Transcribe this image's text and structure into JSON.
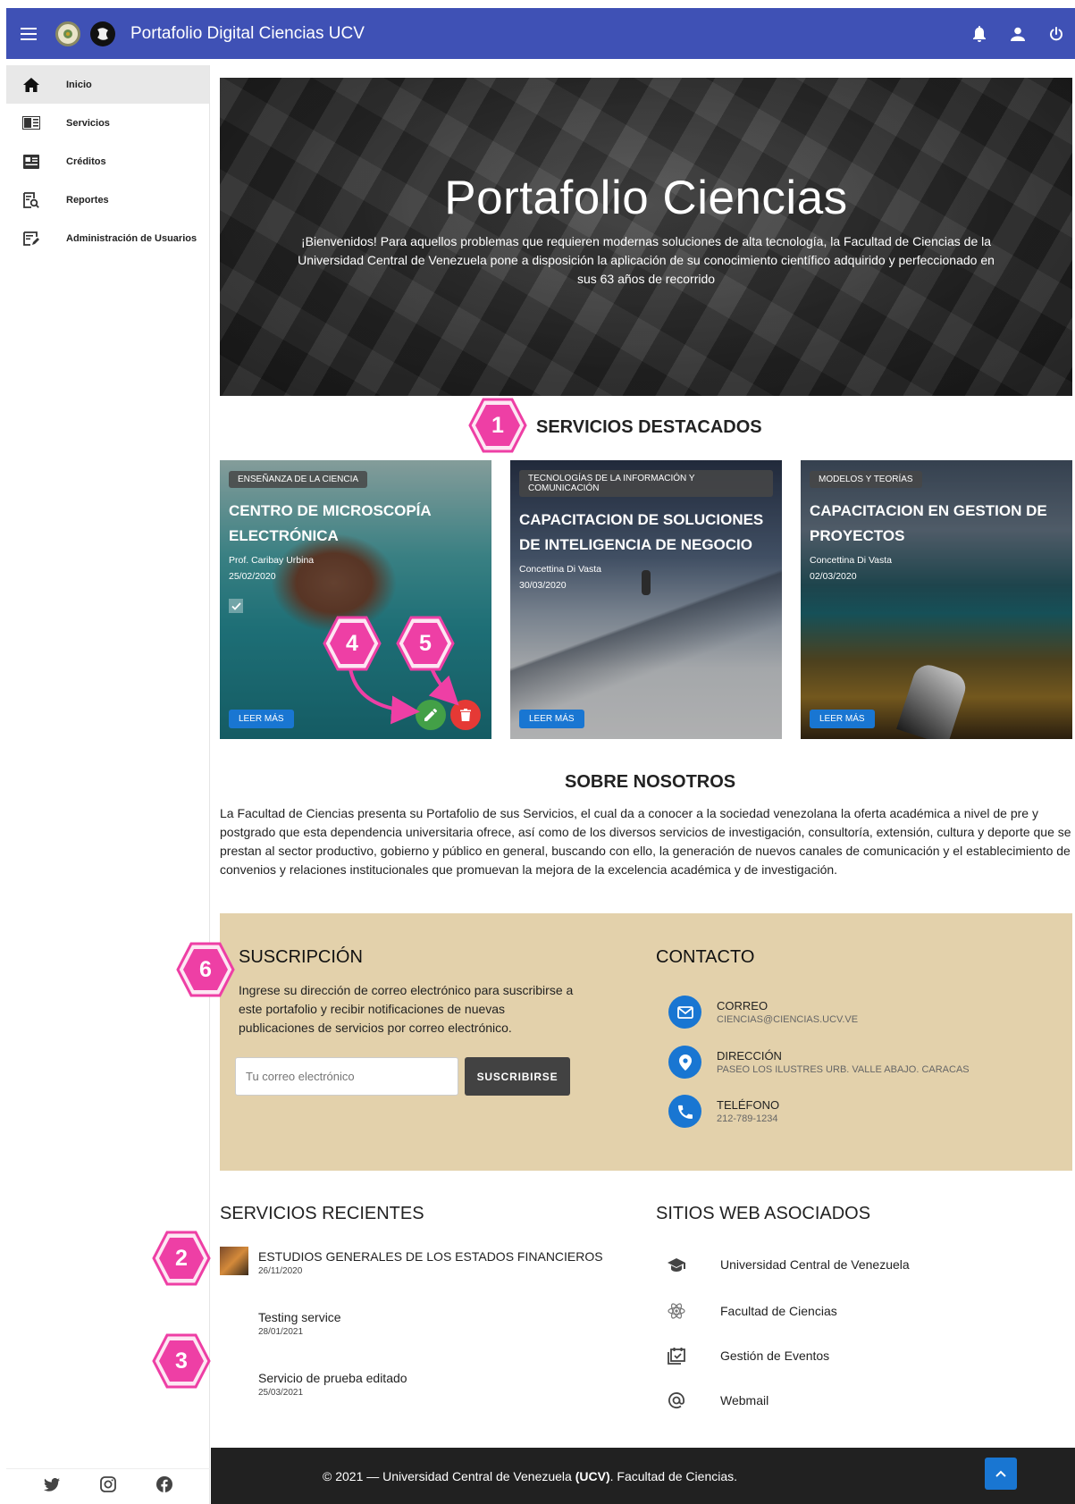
{
  "appbar": {
    "title": "Portafolio Digital Ciencias UCV"
  },
  "sidebar": {
    "items": [
      {
        "label": "Inicio"
      },
      {
        "label": "Servicios"
      },
      {
        "label": "Créditos"
      },
      {
        "label": "Reportes"
      },
      {
        "label": "Administración de Usuarios"
      }
    ]
  },
  "hero": {
    "title": "Portafolio Ciencias",
    "text": "¡Bienvenidos! Para aquellos problemas que requieren modernas soluciones de alta tecnología, la Facultad de Ciencias de la Universidad Central de Venezuela pone a disposición la aplicación de su conocimiento científico adquirido y perfeccionado en sus 63 años de recorrido"
  },
  "featured": {
    "title": "SERVICIOS DESTACADOS",
    "read_more": "LEER MÁS",
    "cards": [
      {
        "category": "ENSEÑANZA DE LA CIENCIA",
        "title": "CENTRO DE MICROSCOPÍA ELECTRÓNICA",
        "author": "Prof. Caribay Urbina",
        "date": "25/02/2020"
      },
      {
        "category": "TECNOLOGÍAS DE LA INFORMACIÓN Y COMUNICACIÓN",
        "title": "CAPACITACION DE SOLUCIONES DE INTELIGENCIA DE NEGOCIO",
        "author": "Concettina Di Vasta",
        "date": "30/03/2020"
      },
      {
        "category": "MODELOS Y TEORÍAS",
        "title": "CAPACITACION EN GESTION DE PROYECTOS",
        "author": "Concettina Di Vasta",
        "date": "02/03/2020"
      }
    ]
  },
  "about": {
    "title": "SOBRE NOSOTROS",
    "text": "La Facultad de Ciencias presenta su Portafolio de sus Servicios, el cual da a conocer a la sociedad venezolana la oferta académica a nivel de pre y postgrado que esta dependencia universitaria ofrece, así como de los diversos servicios de investigación, consultoría, extensión, cultura y deporte que se prestan al sector productivo, gobierno y público en general, buscando con ello, la generación de nuevos canales de comunicación y el establecimiento de convenios y relaciones institucionales que promuevan la mejora de la excelencia académica y de investigación."
  },
  "subscription": {
    "title": "SUSCRIPCIÓN",
    "text": "Ingrese su dirección de correo electrónico para suscribirse a este portafolio y recibir notificaciones de nuevas publicaciones de servicios por correo electrónico.",
    "placeholder": "Tu correo electrónico",
    "button": "SUSCRIBIRSE"
  },
  "contact": {
    "title": "CONTACTO",
    "rows": [
      {
        "label": "CORREO",
        "value": "CIENCIAS@CIENCIAS.UCV.VE",
        "icon": "mail-icon"
      },
      {
        "label": "DIRECCIÓN",
        "value": "PASEO LOS ILUSTRES URB. VALLE ABAJO. CARACAS",
        "icon": "location-icon"
      },
      {
        "label": "TELÉFONO",
        "value": "212-789-1234",
        "icon": "phone-icon"
      }
    ]
  },
  "recent": {
    "title": "SERVICIOS RECIENTES",
    "items": [
      {
        "title": "ESTUDIOS GENERALES DE LOS ESTADOS FINANCIEROS",
        "date": "26/11/2020"
      },
      {
        "title": "Testing service",
        "date": "28/01/2021"
      },
      {
        "title": "Servicio de prueba editado",
        "date": "25/03/2021"
      }
    ]
  },
  "sites": {
    "title": "SITIOS WEB ASOCIADOS",
    "items": [
      {
        "label": "Universidad Central de Venezuela",
        "icon": "graduation-cap-icon"
      },
      {
        "label": "Facultad de Ciencias",
        "icon": "atom-icon"
      },
      {
        "label": "Gestión de Eventos",
        "icon": "calendar-check-icon"
      },
      {
        "label": "Webmail",
        "icon": "at-sign-icon"
      }
    ]
  },
  "footer": {
    "prefix": "© 2021 — Universidad Central de Venezuela ",
    "bold": "(UCV)",
    "suffix": ". Facultad de Ciencias."
  },
  "markers": [
    "1",
    "2",
    "3",
    "4",
    "5",
    "6"
  ],
  "colors": {
    "appbar": "#3f51b5",
    "band": "#e3d1ab",
    "accent": "#1976d2",
    "marker": "#ee3fa5",
    "footer": "#212121"
  }
}
